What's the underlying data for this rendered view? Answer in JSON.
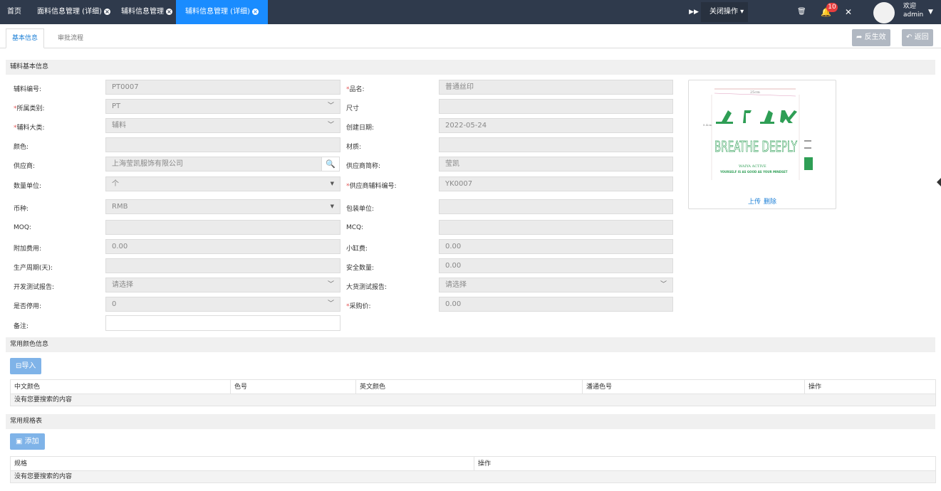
{
  "topbar": {
    "tabs": [
      {
        "label": "首页"
      },
      {
        "label": "面料信息管理 (详细)"
      },
      {
        "label": "辅料信息管理"
      },
      {
        "label": "辅料信息管理 (详细)"
      }
    ],
    "close_ops_label": "关闭操作",
    "notification_count": "10",
    "welcome": "欢迎",
    "username": "admin",
    "colors": {
      "bar": "#2f3a4c",
      "active_tab": "#1a8cff",
      "badge": "#e83e3e"
    }
  },
  "subtabs": {
    "basic_info": "基本信息",
    "approval_flow": "审批流程"
  },
  "actions": {
    "unapprove": "反生效",
    "back": "返回"
  },
  "sections": {
    "basic": "辅料基本信息",
    "colors": "常用颜色信息",
    "specs": "常用规格表"
  },
  "form": {
    "accessory_no": {
      "label": "辅料编号:",
      "value": "PT0007"
    },
    "category": {
      "label": "所属类别:",
      "value": "PT"
    },
    "major_class": {
      "label": "辅料大类:",
      "value": "辅料"
    },
    "color": {
      "label": "颜色:",
      "value": ""
    },
    "supplier": {
      "label": "供应商:",
      "value": "上海莹凯服饰有限公司"
    },
    "qty_unit": {
      "label": "数量单位:",
      "value": "个"
    },
    "currency": {
      "label": "币种:",
      "value": "RMB"
    },
    "moq": {
      "label": "MOQ:",
      "value": ""
    },
    "extra_fee": {
      "label": "附加费用:",
      "value": "0.00"
    },
    "lead_time": {
      "label": "生产周期(天):",
      "value": ""
    },
    "dev_test_report": {
      "label": "开发测试报告:",
      "value": "请选择"
    },
    "disabled": {
      "label": "是否停用:",
      "value": "0"
    },
    "remark": {
      "label": "备注:",
      "value": ""
    },
    "product_name": {
      "label": "品名:",
      "value": "普通丝印"
    },
    "size": {
      "label": "尺寸",
      "value": ""
    },
    "created_date": {
      "label": "创建日期:",
      "value": "2022-05-24"
    },
    "material": {
      "label": "材质:",
      "value": ""
    },
    "supplier_short": {
      "label": "供应商简称:",
      "value": "莹凯"
    },
    "supplier_part_no": {
      "label": "供应商辅料编号:",
      "value": "YK0007"
    },
    "pack_unit": {
      "label": "包装单位:",
      "value": ""
    },
    "mcq": {
      "label": "MCQ:",
      "value": ""
    },
    "small_cylinder_fee": {
      "label": "小缸费:",
      "value": "0.00"
    },
    "safety_qty": {
      "label": "安全数量:",
      "value": "0.00"
    },
    "bulk_test_report": {
      "label": "大货测试报告:",
      "value": "请选择"
    },
    "purchase_price": {
      "label": "采购价:",
      "value": "0.00"
    }
  },
  "image": {
    "upload": "上传",
    "delete": "删除",
    "artwork_text": [
      "BREATHE DEEPLY",
      "WAIYA ACTIVE",
      "YOURSELF IS AS GOOD AS YOUR MINDSET"
    ],
    "artwork_color": "#2e9e55"
  },
  "colors_table": {
    "import_label": "导入",
    "headers": [
      "中文颜色",
      "色号",
      "英文颜色",
      "潘通色号",
      "操作"
    ],
    "empty": "没有您要搜索的内容"
  },
  "specs_table": {
    "add_label": "添加",
    "headers": [
      "规格",
      "操作"
    ],
    "empty": "没有您要搜索的内容"
  }
}
